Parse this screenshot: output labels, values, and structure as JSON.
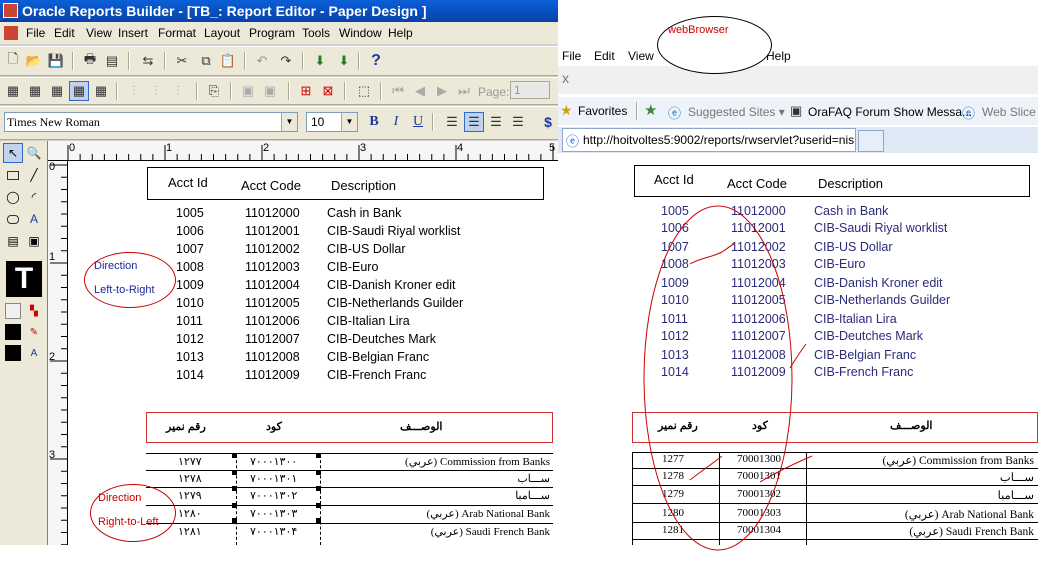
{
  "left_window": {
    "title": "Oracle Reports Builder - [TB_: Report Editor - Paper Design ]",
    "menu": [
      "File",
      "Edit",
      "View",
      "Insert",
      "Format",
      "Layout",
      "Program",
      "Tools",
      "Window",
      "Help"
    ],
    "font_name": "Times New Roman",
    "font_size": "10",
    "page_label": "Page:",
    "page_value": "1",
    "format_buttons": {
      "bold": "B",
      "italic": "I",
      "underline": "U"
    },
    "ruler_h": [
      "0",
      "1",
      "2",
      "3",
      "4",
      "5"
    ],
    "ruler_v": [
      "0",
      "1",
      "2",
      "3"
    ],
    "annotation_ltr": {
      "line1": "Direction",
      "line2": "Left-to-Right"
    },
    "annotation_rtl": {
      "line1": "Direction",
      "line2": "Right-to-Left"
    }
  },
  "right_window": {
    "menu": [
      "File",
      "Edit",
      "View",
      "Help"
    ],
    "annotation": "webBrowser",
    "close_glyph": "x",
    "favorites_label": "Favorites",
    "fav_items": [
      "Suggested Sites ▾",
      "OraFAQ Forum Show Messa...",
      "Web Slice Ga"
    ],
    "url": "http://hoitvoltes5:9002/reports/rwservlet?userid=nis..."
  },
  "report_en": {
    "headers": [
      "Acct Id",
      "Acct Code",
      "Description"
    ],
    "rows": [
      [
        "1005",
        "11012000",
        "Cash in Bank"
      ],
      [
        "1006",
        "11012001",
        "CIB-Saudi Riyal worklist"
      ],
      [
        "1007",
        "11012002",
        "CIB-US Dollar"
      ],
      [
        "1008",
        "11012003",
        "CIB-Euro"
      ],
      [
        "1009",
        "11012004",
        "CIB-Danish Kroner edit"
      ],
      [
        "1010",
        "11012005",
        "CIB-Netherlands Guilder"
      ],
      [
        "1011",
        "11012006",
        "CIB-Italian Lira"
      ],
      [
        "1012",
        "11012007",
        "CIB-Deutches Mark"
      ],
      [
        "1013",
        "11012008",
        "CIB-Belgian Franc"
      ],
      [
        "1014",
        "11012009",
        "CIB-French Franc"
      ]
    ]
  },
  "report_ar": {
    "headers": [
      "رقم نمير",
      "كود",
      "الوصـــف"
    ],
    "rows_left": [
      [
        "۱۲۷۷",
        "۷۰۰۰۱۳۰۰",
        "Commission from Banks (عربي)"
      ],
      [
        "۱۲۷۸",
        "۷۰۰۰۱۳۰۱",
        "ســـاب"
      ],
      [
        "۱۲۷۹",
        "۷۰۰۰۱۳۰۲",
        "ســـامبا"
      ],
      [
        "۱۲۸۰",
        "۷۰۰۰۱۳۰۳",
        "Arab National Bank (عربي)"
      ],
      [
        "۱۲۸۱",
        "۷۰۰۰۱۳۰۴",
        "Saudi French Bank (عربي)"
      ]
    ],
    "rows_right": [
      [
        "1277",
        "70001300",
        "Commission from Banks (عربي)"
      ],
      [
        "1278",
        "70001301",
        "ســـاب"
      ],
      [
        "1279",
        "70001302",
        "ســـامبا"
      ],
      [
        "1280",
        "70001303",
        "Arab National Bank (عربي)"
      ],
      [
        "1281",
        "70001304",
        "Saudi French Bank (عربي)"
      ]
    ]
  }
}
